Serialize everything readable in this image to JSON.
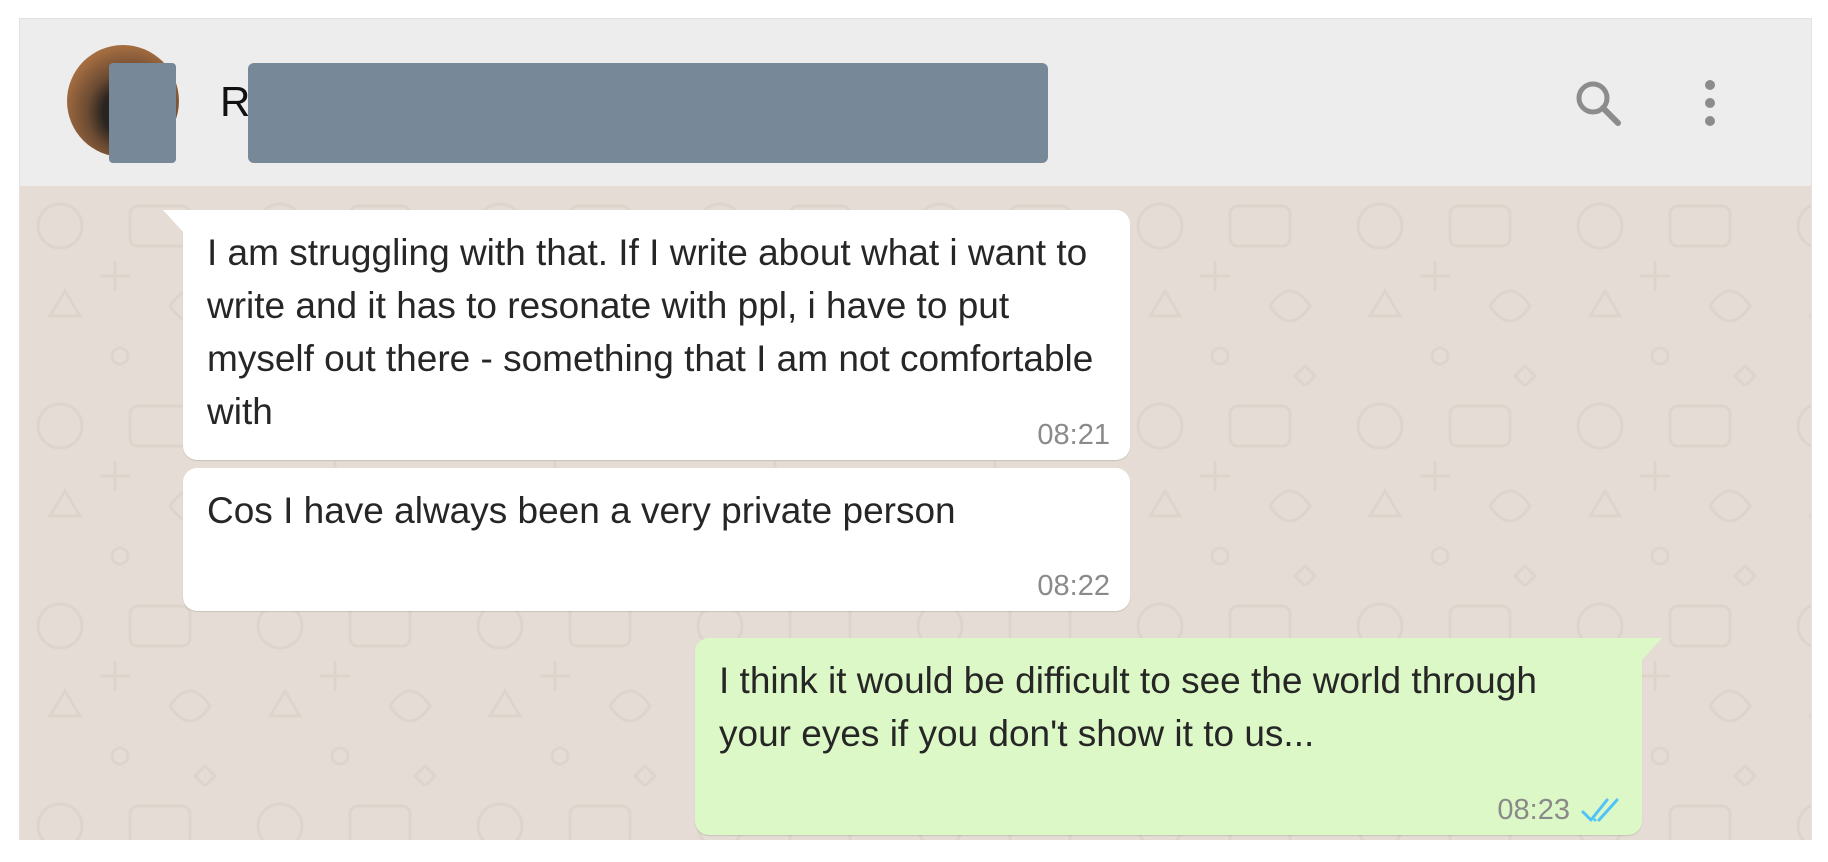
{
  "header": {
    "contact_name_visible": "R",
    "search_icon": "search-icon",
    "menu_icon": "more-vertical-icon"
  },
  "colors": {
    "header_bg": "#ededed",
    "chat_bg": "#e5ddd5",
    "incoming_bubble": "#ffffff",
    "outgoing_bubble": "#dcf8c6",
    "read_ticks": "#4fc3f7",
    "redaction": "#778898"
  },
  "messages": [
    {
      "direction": "incoming",
      "text": "I am struggling with that. If I write about what i want to write and it has to resonate with ppl, i have to put myself out there - something that I am not comfortable with",
      "time": "08:21"
    },
    {
      "direction": "incoming",
      "text": "Cos I have always been a very private person",
      "time": "08:22"
    },
    {
      "direction": "outgoing",
      "text": "I think it would be difficult to see the world through your eyes if you don't show it to us...",
      "time": "08:23",
      "status_icon": "double-check-read-icon"
    }
  ]
}
